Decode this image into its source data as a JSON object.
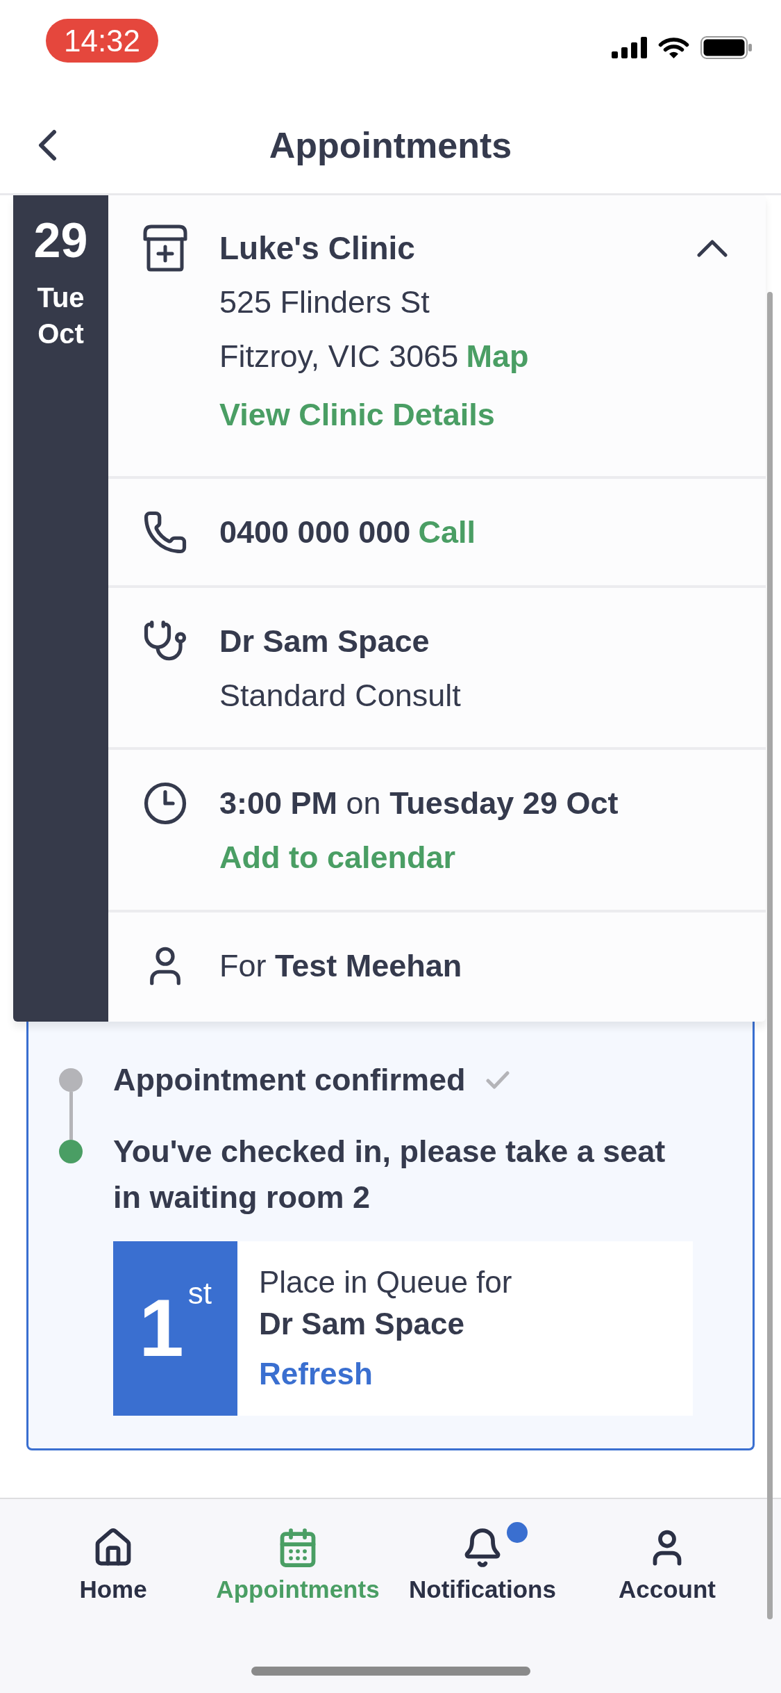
{
  "status_bar": {
    "time": "14:32"
  },
  "header": {
    "title": "Appointments"
  },
  "appointment": {
    "expanded": true,
    "date": {
      "day": "29",
      "weekday": "Tue",
      "month": "Oct"
    },
    "sections": [
      {
        "kind": "clinic",
        "name": "Luke's Clinic",
        "street": "525 Flinders St",
        "suburb": "Fitzroy, VIC 3065",
        "map_link": "Map",
        "details_link": "View Clinic Details"
      },
      {
        "kind": "phone",
        "number": "0400 000 000",
        "call_link": "Call"
      },
      {
        "kind": "doctor",
        "name": "Dr Sam Space",
        "consult": "Standard Consult"
      },
      {
        "kind": "time",
        "when": "**3:00 PM** on **Tuesday 29 Oct**",
        "calendar_link": "Add to calendar"
      },
      {
        "kind": "patient",
        "text": "For **Test Meehan**"
      }
    ]
  },
  "progress": {
    "steps": [
      {
        "label": "Appointment confirmed",
        "checked": true,
        "active": false
      },
      {
        "label": "You've checked in, please take a seat in waiting room 2",
        "checked": false,
        "active": true
      }
    ],
    "queue": {
      "position": "1$^{st}$",
      "label": "Place in Queue for",
      "doctor": "Dr Sam Space",
      "refresh_link": "Refresh"
    }
  },
  "tabs": [
    {
      "label": "Home",
      "selected": false,
      "badge": false
    },
    {
      "label": "Appointments",
      "selected": true,
      "badge": false
    },
    {
      "label": "Notifications",
      "selected": false,
      "badge": true
    },
    {
      "label": "Account",
      "selected": false,
      "badge": false
    }
  ]
}
